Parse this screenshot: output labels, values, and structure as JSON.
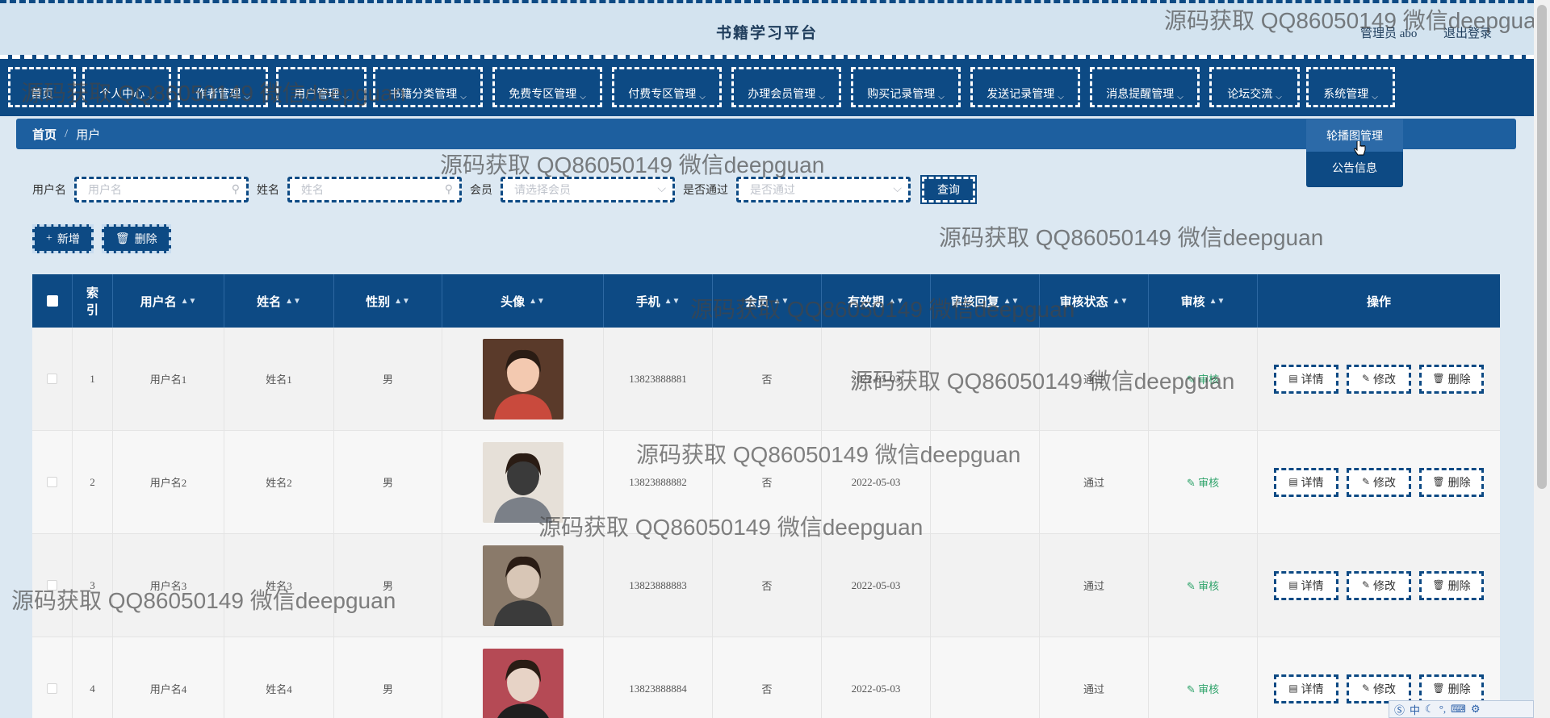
{
  "header": {
    "title": "书籍学习平台",
    "user": "管理员 abo",
    "logout": "退出登录"
  },
  "nav": [
    {
      "label": "首页",
      "dropdown": false
    },
    {
      "label": "个人中心",
      "dropdown": true
    },
    {
      "label": "作者管理",
      "dropdown": true
    },
    {
      "label": "用户管理",
      "dropdown": true
    },
    {
      "label": "书籍分类管理",
      "dropdown": true
    },
    {
      "label": "免费专区管理",
      "dropdown": true
    },
    {
      "label": "付费专区管理",
      "dropdown": true
    },
    {
      "label": "办理会员管理",
      "dropdown": true
    },
    {
      "label": "购买记录管理",
      "dropdown": true
    },
    {
      "label": "发送记录管理",
      "dropdown": true
    },
    {
      "label": "消息提醒管理",
      "dropdown": true
    },
    {
      "label": "论坛交流",
      "dropdown": true
    },
    {
      "label": "系统管理",
      "dropdown": true
    }
  ],
  "dropdown": {
    "items": [
      "轮播图管理",
      "公告信息"
    ]
  },
  "breadcrumb": {
    "home": "首页",
    "sep": "/",
    "current": "用户"
  },
  "search": {
    "username_label": "用户名",
    "username_placeholder": "用户名",
    "name_label": "姓名",
    "name_placeholder": "姓名",
    "member_label": "会员",
    "member_placeholder": "请选择会员",
    "pass_label": "是否通过",
    "pass_placeholder": "是否通过",
    "query": "查询"
  },
  "actions": {
    "add": "新增",
    "delete": "删除"
  },
  "table": {
    "headers": [
      "索引",
      "用户名",
      "姓名",
      "性别",
      "头像",
      "手机",
      "会员",
      "有效期",
      "审核回复",
      "审核状态",
      "审核",
      "操作"
    ],
    "rows": [
      {
        "index": "1",
        "username": "用户名1",
        "name": "姓名1",
        "gender": "男",
        "phone": "13823888881",
        "member": "否",
        "expiry": "2022-05-03",
        "reply": "",
        "status": "通过",
        "audit": "审核"
      },
      {
        "index": "2",
        "username": "用户名2",
        "name": "姓名2",
        "gender": "男",
        "phone": "13823888882",
        "member": "否",
        "expiry": "2022-05-03",
        "reply": "",
        "status": "通过",
        "audit": "审核"
      },
      {
        "index": "3",
        "username": "用户名3",
        "name": "姓名3",
        "gender": "男",
        "phone": "13823888883",
        "member": "否",
        "expiry": "2022-05-03",
        "reply": "",
        "status": "通过",
        "audit": "审核"
      },
      {
        "index": "4",
        "username": "用户名4",
        "name": "姓名4",
        "gender": "男",
        "phone": "13823888884",
        "member": "否",
        "expiry": "2022-05-03",
        "reply": "",
        "status": "通过",
        "audit": "审核"
      }
    ],
    "op_detail": "详情",
    "op_edit": "修改",
    "op_delete": "删除"
  },
  "watermark": "源码获取 QQ86050149 微信deepguan",
  "ime": {
    "label": "中"
  },
  "colors": {
    "primary": "#0d4a84",
    "breadcrumb": "#1d5f9f",
    "page_bg": "#dce8f2",
    "audit_green": "#2ea36a"
  }
}
